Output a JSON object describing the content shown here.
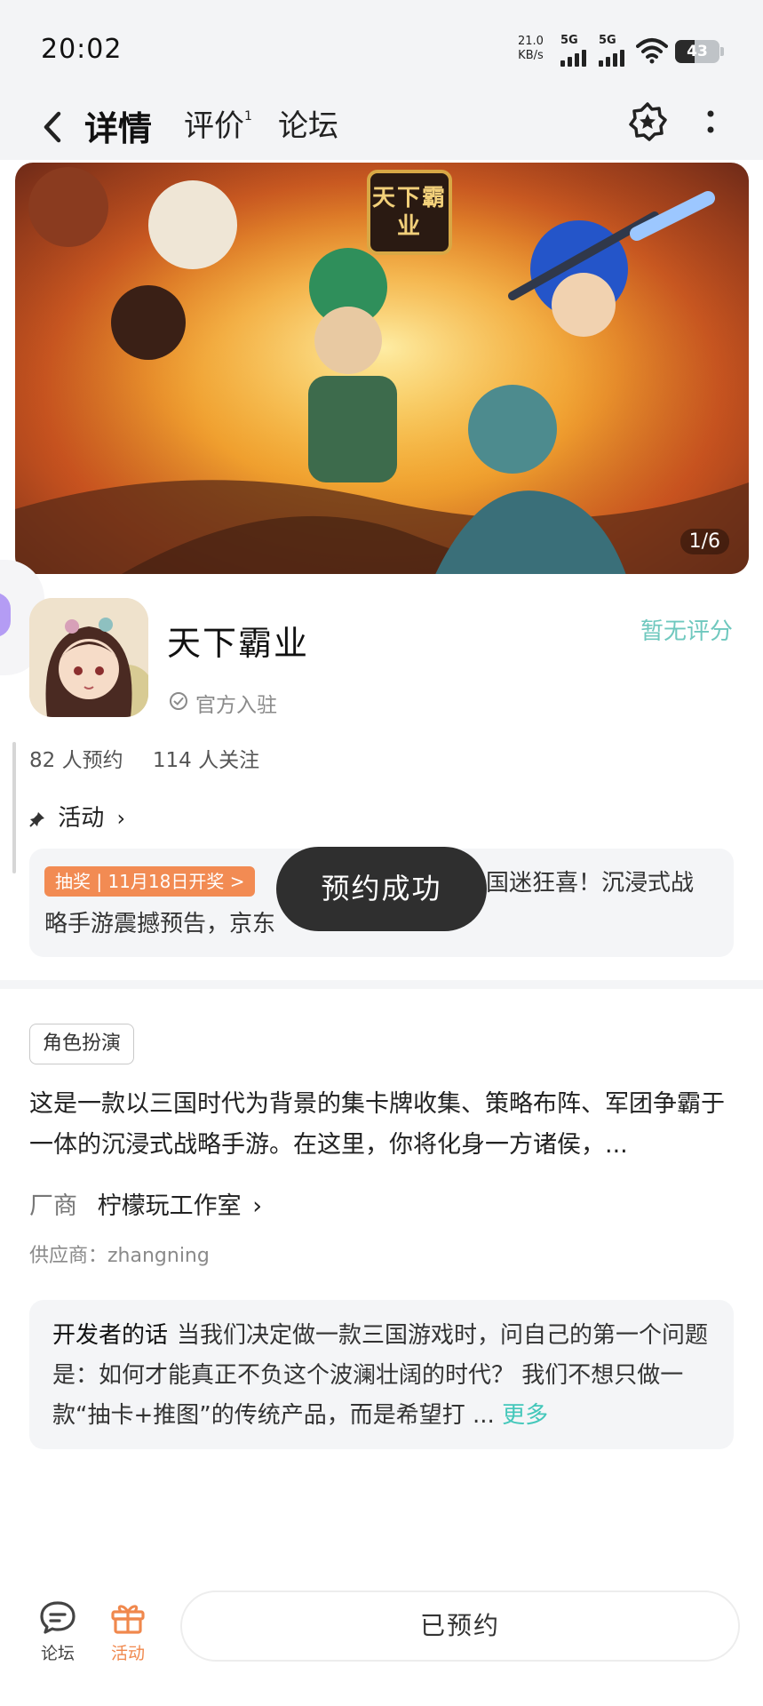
{
  "status_bar": {
    "time": "20:02",
    "net_speed_value": "21.0",
    "net_speed_unit": "KB/s",
    "signal_1_label": "5G",
    "signal_2_label": "5G",
    "battery_level": "43"
  },
  "nav": {
    "tabs": [
      {
        "label": "详情",
        "active": true
      },
      {
        "label": "评价",
        "badge": "1"
      },
      {
        "label": "论坛"
      }
    ],
    "icons": [
      "back-icon",
      "star-badge-icon",
      "more-vertical-icon"
    ],
    "accent_color": "#43c7ba"
  },
  "banner": {
    "title_art": "天下霸业",
    "page_indicator": "1/6"
  },
  "app": {
    "name": "天下霸业",
    "rating_text": "暂无评分",
    "official_label": "官方入驻",
    "reservations": "82 人预约",
    "followers": "114 人关注"
  },
  "activity": {
    "label": "活动",
    "tag": "抽奖 | 11月18日开奖 >",
    "text_line1": "国迷狂喜！沉浸式战",
    "text_line2": "略手游震撼预告，京东"
  },
  "toast": {
    "message": "预约成功"
  },
  "details": {
    "genre": "角色扮演",
    "description": "这是一款以三国时代为背景的集卡牌收集、策略布阵、军团争霸于一体的沉浸式战略手游。在这里，你将化身一方诸侯，...",
    "developer_label": "厂商",
    "developer_name": "柠檬玩工作室",
    "supplier": "供应商：zhangning"
  },
  "developer_note": {
    "title": "开发者的话",
    "body": "当我们决定做一款三国游戏时，问自己的第一个问题是：如何才能真正不负这个波澜壮阔的时代？ 我们不想只做一款“抽卡+推图”的传统产品，而是希望打 ... ",
    "more": "更多"
  },
  "bottom_bar": {
    "forum_label": "论坛",
    "activity_label": "活动",
    "action_button": "已预约",
    "activity_color": "#f0884d"
  }
}
